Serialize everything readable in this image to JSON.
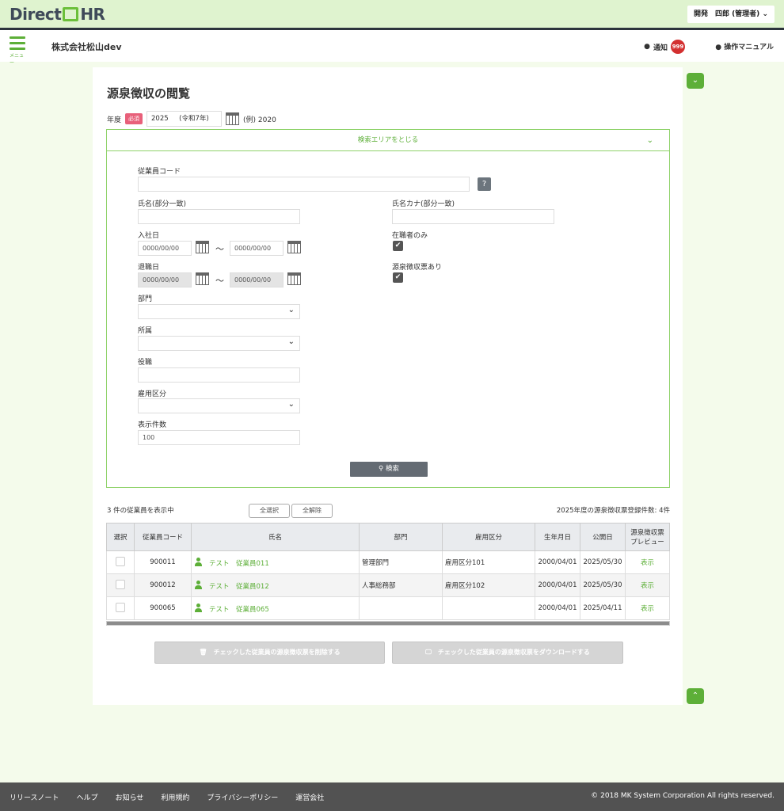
{
  "header": {
    "logo_left": "Direct",
    "logo_right": "HR",
    "user": "開発　四郎 (管理者)",
    "user_chevron": "⌄"
  },
  "subbar": {
    "menu_label": "メニュー",
    "company": "株式会社松山dev",
    "notify_label": "通知",
    "notify_count": "999",
    "manual_label": "操作マニュアル"
  },
  "page": {
    "title": "源泉徴収の閲覧",
    "year_label": "年度",
    "required": "必須",
    "year_value": "2025",
    "era": "(令和7年)",
    "example": "(例) 2020"
  },
  "search": {
    "toggle_label": "検索エリアをとじる",
    "employee_code_label": "従業員コード",
    "help_label": "?",
    "name_label": "氏名(部分一致)",
    "kana_label": "氏名カナ(部分一致)",
    "hire_label": "入社日",
    "date_placeholder": "0000/00/00",
    "tilde": "～",
    "active_only_label": "在職者のみ",
    "retire_label": "退職日",
    "has_slip_label": "源泉徴収票あり",
    "dept_label": "部門",
    "affil_label": "所属",
    "position_label": "役職",
    "emptype_label": "雇用区分",
    "limit_label": "表示件数",
    "limit_value": "100",
    "search_button": "検索",
    "check": "✔"
  },
  "results": {
    "count_text": "3 件の従業員を表示中",
    "select_all": "全選択",
    "deselect_all": "全解除",
    "reg_count": "2025年度の源泉徴収票登録件数: 4件",
    "columns": {
      "select": "選択",
      "code": "従業員コード",
      "name": "氏名",
      "dept": "部門",
      "emptype": "雇用区分",
      "birth": "生年月日",
      "publish": "公開日",
      "preview_1": "源泉徴収票",
      "preview_2": "プレビュー"
    },
    "rows": [
      {
        "code": "900011",
        "name": "テスト　従業員011",
        "dept": "管理部門",
        "emptype": "雇用区分101",
        "birth": "2000/04/01",
        "publish": "2025/05/30",
        "preview": "表示"
      },
      {
        "code": "900012",
        "name": "テスト　従業員012",
        "dept": "人事総務部",
        "emptype": "雇用区分102",
        "birth": "2000/04/01",
        "publish": "2025/05/30",
        "preview": "表示"
      },
      {
        "code": "900065",
        "name": "テスト　従業員065",
        "dept": "",
        "emptype": "",
        "birth": "2000/04/01",
        "publish": "2025/04/11",
        "preview": "表示"
      }
    ],
    "delete_button": "🗑　チェックした従業員の源泉徴収票を削除する",
    "download_button": "🖵　チェックした従業員の源泉徴収票をダウンロードする"
  },
  "footer": {
    "links": [
      "リリースノート",
      "ヘルプ",
      "お知らせ",
      "利用規約",
      "プライバシーポリシー",
      "運営会社"
    ],
    "copyright": "© 2018 MK System Corporation All rights reserved."
  },
  "colors": {
    "accent": "#5daf38",
    "topbar": "#dff3cf",
    "badge": "#d32f2f"
  }
}
